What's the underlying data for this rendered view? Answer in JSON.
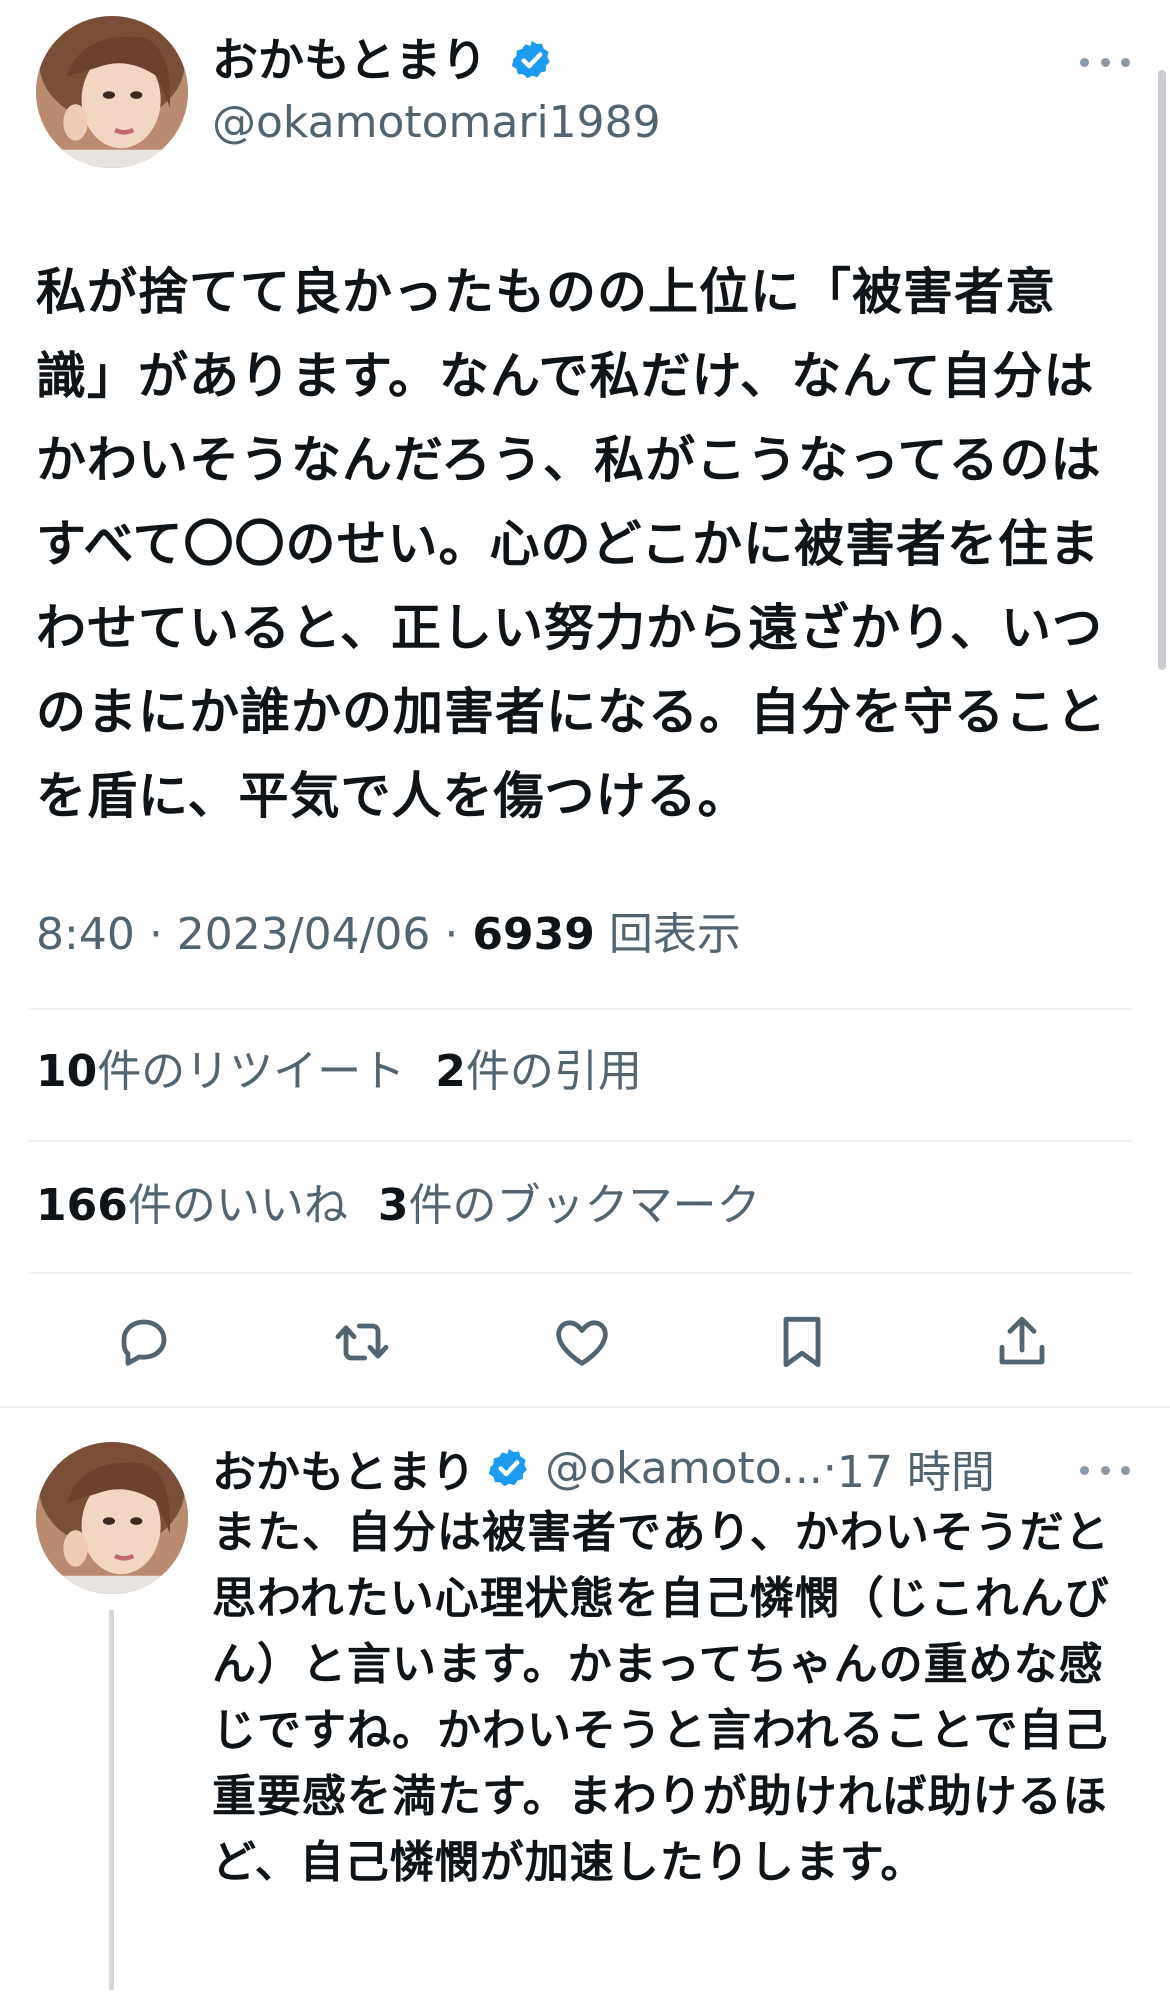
{
  "main_tweet": {
    "author_name": "おかもとまり",
    "author_handle": "@okamotomari1989",
    "text": "私が捨てて良かったものの上位に「被害者意識」があります。なんで私だけ、なんて自分はかわいそうなんだろう、私がこうなってるのはすべて〇〇のせい。心のどこかに被害者を住まわせていると、正しい努力から遠ざかり、いつのまにか誰かの加害者になる。自分を守ることを盾に、平気で人を傷つける。",
    "time": "8:40",
    "date": "2023/04/06",
    "views_count": "6939",
    "views_label": "回表示",
    "retweets_count": "10",
    "retweets_label": "件のリツイート",
    "quotes_count": "2",
    "quotes_label": "件の引用",
    "likes_count": "166",
    "likes_label": "件のいいね",
    "bookmarks_count": "3",
    "bookmarks_label": "件のブックマーク"
  },
  "actions": [
    {
      "icon": "reply-icon"
    },
    {
      "icon": "retweet-icon"
    },
    {
      "icon": "like-icon"
    },
    {
      "icon": "bookmark-icon"
    },
    {
      "icon": "share-icon"
    }
  ],
  "reply_tweet": {
    "author_name": "おかもとまり",
    "author_handle": "@okamoto...",
    "time_ago": "17 時間",
    "text": "また、自分は被害者であり、かわいそうだと思われたい心理状態を自己憐憫（じこれんびん）と言います。かまってちゃんの重めな感じですね。かわいそうと言われることで自己重要感を満たす。まわりが助ければ助けるほど、自己憐憫が加速したりします。"
  },
  "colors": {
    "text_primary": "#0f1419",
    "text_secondary": "#536471",
    "verified_blue": "#1d9bf0",
    "divider": "#eff3f4"
  }
}
